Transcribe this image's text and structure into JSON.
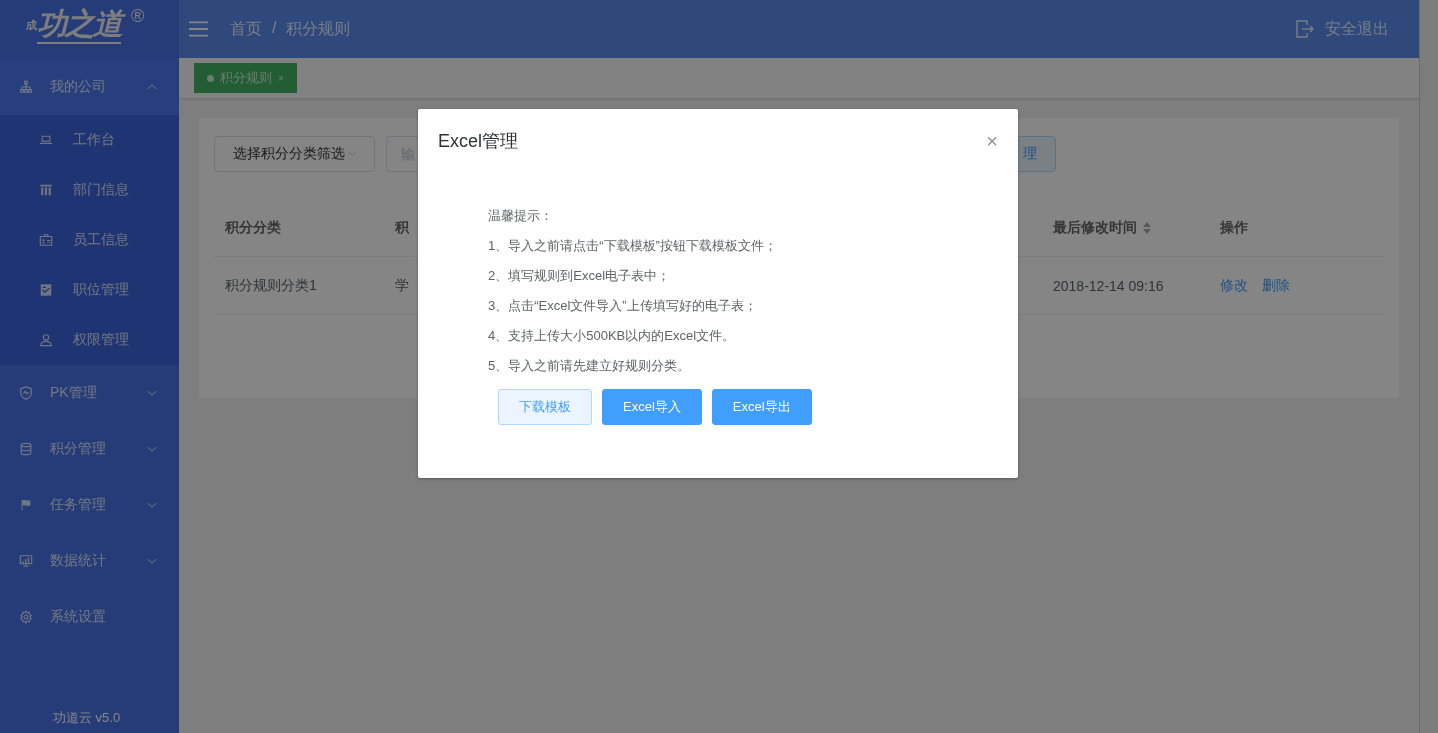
{
  "logo": {
    "prefix": "成",
    "name": "功之道",
    "mark": "®"
  },
  "sidebar": {
    "items": [
      {
        "label": "我的公司",
        "expanded": true,
        "children": [
          {
            "label": "工作台"
          },
          {
            "label": "部门信息"
          },
          {
            "label": "员工信息"
          },
          {
            "label": "职位管理"
          },
          {
            "label": "权限管理"
          }
        ]
      },
      {
        "label": "PK管理",
        "expanded": false
      },
      {
        "label": "积分管理",
        "expanded": false
      },
      {
        "label": "任务管理",
        "expanded": false
      },
      {
        "label": "数据统计",
        "expanded": false
      },
      {
        "label": "系统设置"
      }
    ],
    "footer": "功道云 v5.0"
  },
  "header": {
    "breadcrumb": [
      "首页",
      "积分规则"
    ],
    "separator": "/",
    "logout": "安全退出"
  },
  "tabs": [
    {
      "label": "积分规则",
      "selected": true,
      "close": "×"
    }
  ],
  "filters": {
    "select": "选择积分分类筛选",
    "input_placeholder": "输",
    "button": "理"
  },
  "table": {
    "columns": [
      {
        "label": "积分分类",
        "sortable": false
      },
      {
        "label": "积",
        "sortable": false
      },
      {
        "label": "最后修改时间",
        "sortable": true
      },
      {
        "label": "操作",
        "sortable": false
      }
    ],
    "rows": [
      {
        "cells": [
          "积分规则分类1",
          "学",
          "2018-12-14 09:16"
        ],
        "actions": [
          "修改",
          "删除"
        ]
      }
    ]
  },
  "dialog": {
    "title": "Excel管理",
    "close": "×",
    "tips": [
      "温馨提示：",
      "1、导入之前请点击“下载模板”按钮下载模板文件；",
      "2、填写规则到Excel电子表中；",
      "3、点击“Excel文件导入”上传填写好的电子表；",
      "4、支持上传大小500KB以内的Excel文件。",
      "5、导入之前请先建立好规则分类。"
    ],
    "buttons": [
      {
        "label": "下载模板",
        "kind": "plain"
      },
      {
        "label": "Excel导入",
        "kind": "primary"
      },
      {
        "label": "Excel导出",
        "kind": "primary"
      }
    ]
  }
}
